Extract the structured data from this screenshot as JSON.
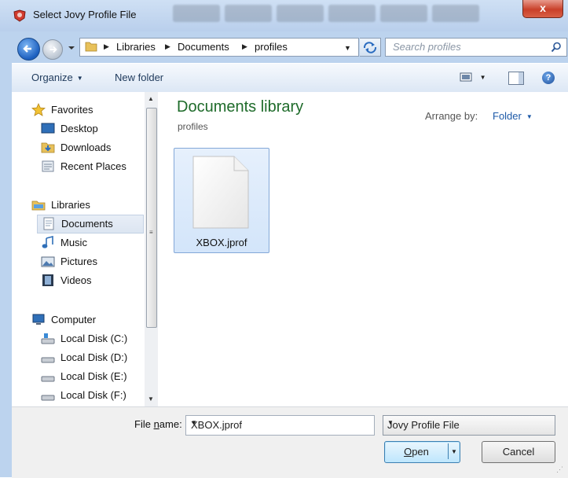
{
  "window": {
    "title": "Select Jovy Profile File",
    "close_glyph": "x"
  },
  "address": {
    "crumbs": [
      "Libraries",
      "Documents",
      "profiles"
    ],
    "search_placeholder": "Search profiles"
  },
  "toolbar": {
    "organize": "Organize",
    "new_folder": "New folder",
    "help": "?"
  },
  "nav": {
    "favorites": {
      "label": "Favorites",
      "items": [
        "Desktop",
        "Downloads",
        "Recent Places"
      ]
    },
    "libraries": {
      "label": "Libraries",
      "items": [
        "Documents",
        "Music",
        "Pictures",
        "Videos"
      ]
    },
    "computer": {
      "label": "Computer",
      "items": [
        "Local Disk (C:)",
        "Local Disk (D:)",
        "Local Disk (E:)",
        "Local Disk (F:)"
      ]
    },
    "selected": "Documents"
  },
  "content": {
    "title": "Documents library",
    "subtitle": "profiles",
    "arrange_label": "Arrange by:",
    "arrange_value": "Folder",
    "files": [
      {
        "name": "XBOX.jprof"
      }
    ]
  },
  "footer": {
    "file_name_label_pre": "File ",
    "file_name_label_u": "n",
    "file_name_label_post": "ame:",
    "file_name_value": "XBOX.jprof",
    "file_type": "Jovy Profile File",
    "open_u": "O",
    "open_rest": "pen",
    "cancel": "Cancel"
  },
  "colors": {
    "library_title": "#1e6b2a",
    "link": "#1e5aa8",
    "toolbar_text": "#1e395b"
  }
}
